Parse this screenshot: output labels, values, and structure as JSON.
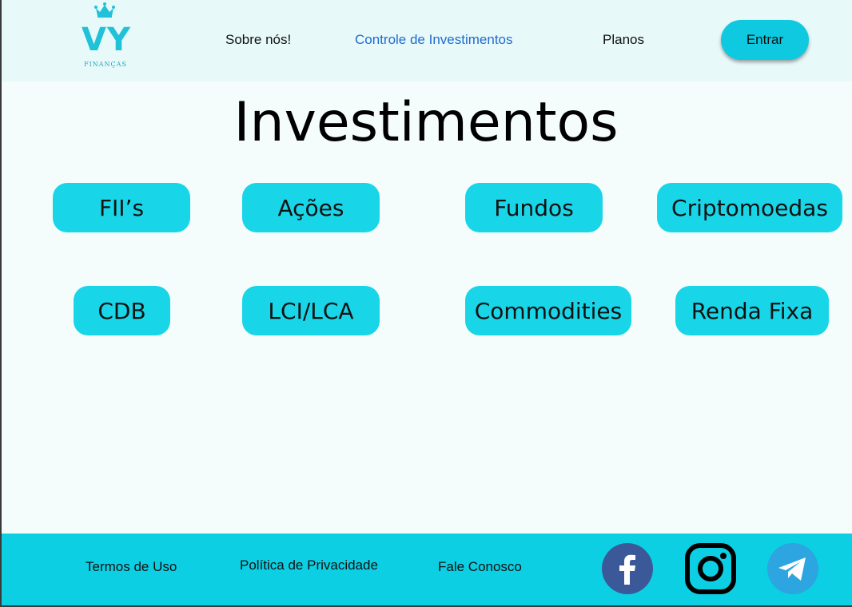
{
  "brand": {
    "name": "VY",
    "subtitle": "FINANÇAS",
    "accent": "#1fc2d8"
  },
  "nav": {
    "items": [
      {
        "label": "Sobre nós!",
        "active": false
      },
      {
        "label": "Controle de Investimentos",
        "active": true
      },
      {
        "label": "Planos",
        "active": false
      }
    ],
    "login_label": "Entrar"
  },
  "main": {
    "title": "Investimentos",
    "categories": [
      {
        "label": "FII’s"
      },
      {
        "label": "Ações"
      },
      {
        "label": "Fundos"
      },
      {
        "label": "Criptomoedas"
      },
      {
        "label": "CDB"
      },
      {
        "label": "LCI/LCA"
      },
      {
        "label": "Commodities"
      },
      {
        "label": "Renda Fixa"
      }
    ]
  },
  "footer": {
    "links": [
      {
        "label": "Termos de Uso"
      },
      {
        "label": "Política de Privacidade"
      },
      {
        "label": "Fale Conosco"
      }
    ],
    "social": [
      {
        "icon": "facebook-icon",
        "color": "#3b5998"
      },
      {
        "icon": "instagram-icon",
        "color": "#000000"
      },
      {
        "icon": "telegram-icon",
        "color": "#2ca5e0"
      }
    ]
  },
  "colors": {
    "header_bg": "#e8f9f9",
    "page_bg": "#f4fdfb",
    "pill": "#19d5e8",
    "footer_bg": "#0ccfe3",
    "active_link": "#1f6bd1"
  }
}
